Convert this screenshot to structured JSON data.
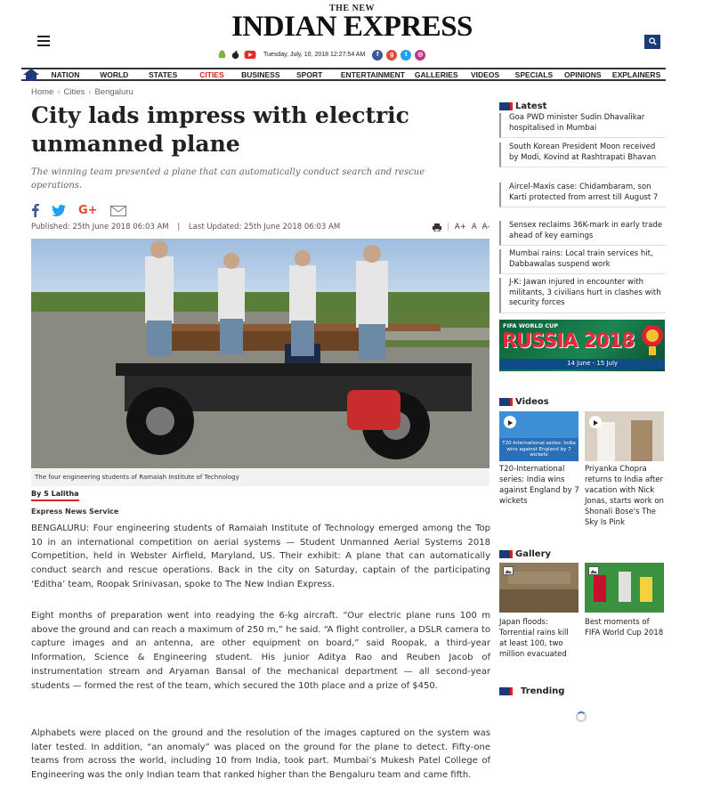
{
  "masthead": {
    "the_new": "THE NEW",
    "brand": "INDIAN EXPRESS",
    "date": "Tuesday, July, 10, 2018  12:27:54 AM"
  },
  "nav": {
    "items": [
      "NATION",
      "WORLD",
      "STATES",
      "CITIES",
      "BUSINESS",
      "SPORT",
      "ENTERTAINMENT",
      "GALLERIES",
      "VIDEOS",
      "SPECIALS",
      "OPINIONS",
      "EXPLAINERS"
    ],
    "active": "CITIES"
  },
  "breadcrumb": {
    "home": "Home",
    "sep": "›",
    "section": "Cities",
    "city": "Bengaluru"
  },
  "article": {
    "headline": "City lads impress with electric unmanned plane",
    "synopsis": "The winning team presented a plane that can automatically conduct search and rescue operations.",
    "published": "Published: 25th June 2018 06:03 AM",
    "divider": "|",
    "updated": "Last Updated: 25th June 2018 06:03 AM",
    "font_tools": {
      "a_plus": "A+",
      "a": "A",
      "a_minus": "A-"
    },
    "caption": "The four engineering students of Ramaiah Institute of Technology",
    "byline": "By S Lalitha",
    "agency": "Express News Service",
    "paragraphs": [
      "BENGALURU: Four engineering students of Ramaiah Institute of Technology emerged among the Top 10 in an international competition on aerial systems — Student Unmanned Aerial Systems 2018 Competition, held in Webster Airfield, Maryland, US. Their exhibit: A plane that can automatically conduct search and rescue operations. Back in the city on Saturday, captain of the participating ‘Editha’ team, Roopak Srinivasan, spoke to The New Indian Express.",
      "Eight months of preparation went into readying the 6-kg aircraft. “Our electric plane runs 100 m above the ground and can reach a maximum of 250 m,” he said. “A flight controller, a DSLR camera to capture images and an antenna, are other equipment on board,” said Roopak, a third-year Information, Science & Engineering student. His junior Aditya Rao and Reuben Jacob of instrumentation stream and Aryaman Bansal of the mechanical department — all second-year students — formed the rest of the team, which secured the 10th place and a prize of $450.",
      "Alphabets were placed on the ground and the resolution of the images captured on the system was later tested. In addition, “an anomaly” was placed on the ground for the plane to detect. Fifty-one teams from across the world, including 10 from India, took part. Mumbai’s  Mukesh Patel College of Engineering was the only Indian team that ranked higher than the Bengaluru team and came fifth."
    ]
  },
  "sidebar": {
    "latest_title": "Latest",
    "latest": [
      "Goa PWD minister Sudin Dhavalikar hospitalised in Mumbai",
      "South Korean President Moon received by Modi, Kovind at Rashtrapati Bhavan",
      "Aircel-Maxis case: Chidambaram, son Karti protected from arrest till August 7",
      "Sensex reclaims 36K-mark in early trade ahead of key earnings",
      "Mumbai rains: Local train services hit, Dabbawalas suspend work",
      "J-K: Jawan injured in encounter with militants, 3 civilians hurt in clashes with security forces"
    ],
    "banner": {
      "tag": "FIFA WORLD CUP",
      "title": "RUSSIA 2018",
      "dates": "14 June - 15 July"
    },
    "videos_title": "Videos",
    "videos": [
      {
        "thumb_text": "T20-International series: India wins against England by 7 wickets",
        "caption": "T20-International series: India wins against England by 7 wickets"
      },
      {
        "caption": "Priyanka Chopra returns to India after vacation with Nick Jonas, starts work on Shonali Bose's The Sky Is Pink"
      }
    ],
    "gallery_title": "Gallery",
    "gallery": [
      {
        "caption": "Japan floods: Torrential rains kill at least 100, two million evacuated"
      },
      {
        "caption": "Best moments of FIFA World Cup 2018"
      }
    ],
    "trending_title": "Trending"
  },
  "colors": {
    "brand_blue": "#1b3a7a",
    "accent_red": "#d2281f"
  }
}
